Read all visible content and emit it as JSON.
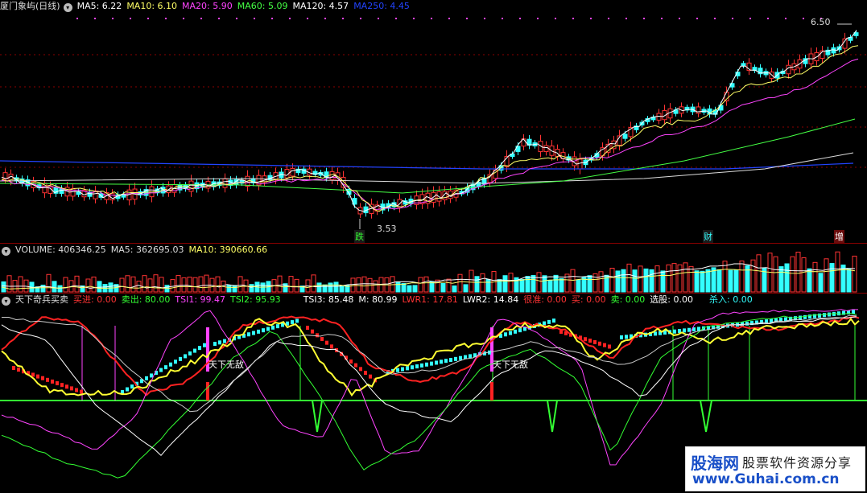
{
  "main": {
    "title": "厦门象屿(日线)",
    "ma": [
      {
        "label": "MA5: 6.22",
        "color": "#ffffff"
      },
      {
        "label": "MA10: 6.10",
        "color": "#ffff66"
      },
      {
        "label": "MA20: 5.90",
        "color": "#ff44ff"
      },
      {
        "label": "MA60: 5.09",
        "color": "#44ff44"
      },
      {
        "label": "MA120: 4.57",
        "color": "#ffffff"
      },
      {
        "label": "MA250: 4.45",
        "color": "#2244ff"
      }
    ],
    "high_label": "6.50",
    "low_label": "3.53",
    "markers": [
      "跌",
      "财",
      "增"
    ]
  },
  "volume": {
    "title": "VOLUME: 406346.25",
    "ma5": "MA5: 362695.03",
    "ma10": "MA10: 390660.66"
  },
  "indicator": {
    "title": "天下奇兵买卖",
    "items": [
      {
        "label": "买进: 0.00",
        "color": "#ff3333"
      },
      {
        "label": "卖出: 80.00",
        "color": "#33ff33"
      },
      {
        "label": "TSI1: 99.47",
        "color": "#ff44ff"
      },
      {
        "label": "TSI2: 95.93",
        "color": "#33ff33"
      },
      {
        "label": "TSI3: 85.48",
        "color": "#ffffff"
      },
      {
        "label": "M: 80.99",
        "color": "#ffffff"
      },
      {
        "label": "LWR1: 17.81",
        "color": "#ff3333"
      },
      {
        "label": "LWR2: 14.84",
        "color": "#ffffff"
      },
      {
        "label": "很准: 0.00",
        "color": "#ff3333"
      },
      {
        "label": "买: 0.00",
        "color": "#ff3333"
      },
      {
        "label": "卖: 0.00",
        "color": "#33ff33"
      },
      {
        "label": "选股: 0.00",
        "color": "#ffffff"
      },
      {
        "label": "杀入: 0.00",
        "color": "#33ffff"
      }
    ],
    "signal_text": "天下无敌"
  },
  "watermark": {
    "brand": "股海网",
    "slogan": "股票软件资源分享",
    "url": "www.Guhai.com.cn"
  }
}
